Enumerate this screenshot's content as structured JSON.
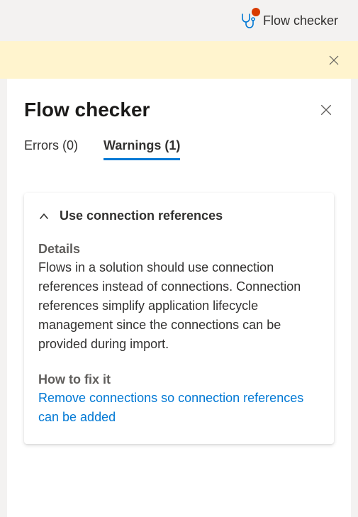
{
  "toolbar": {
    "flow_checker_label": "Flow checker"
  },
  "panel": {
    "title": "Flow checker"
  },
  "tabs": {
    "errors_label": "Errors (0)",
    "warnings_label": "Warnings (1)"
  },
  "card": {
    "title": "Use connection references",
    "details_label": "Details",
    "details_body": "Flows in a solution should use connection references instead of connections. Connection references simplify application lifecycle management since the connections can be provided during import.",
    "fix_label": "How to fix it",
    "fix_link": "Remove connections so connection references can be added"
  }
}
